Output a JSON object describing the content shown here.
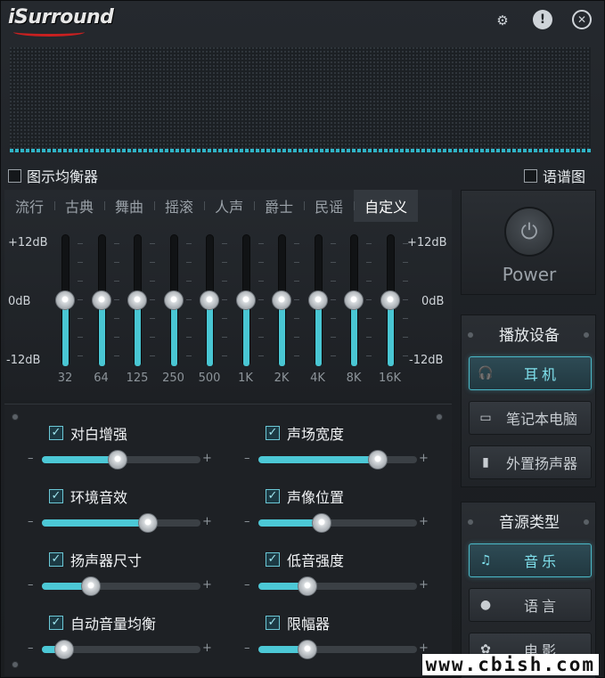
{
  "app": {
    "logo": "iSurround"
  },
  "header_icons": [
    "gear-icon",
    "info-icon",
    "close-icon"
  ],
  "options": {
    "graphic_eq": "图示均衡器",
    "spectrum": "语谱图"
  },
  "presets": [
    "流行",
    "古典",
    "舞曲",
    "摇滚",
    "人声",
    "爵士",
    "民谣",
    "自定义"
  ],
  "active_preset": "自定义",
  "eq": {
    "top_label": "+12dB",
    "mid_label": "0dB",
    "bottom_label": "-12dB",
    "bands": [
      {
        "freq": "32",
        "gain_db": 0
      },
      {
        "freq": "64",
        "gain_db": 0
      },
      {
        "freq": "125",
        "gain_db": 0
      },
      {
        "freq": "250",
        "gain_db": 0
      },
      {
        "freq": "500",
        "gain_db": 0
      },
      {
        "freq": "1K",
        "gain_db": 0
      },
      {
        "freq": "2K",
        "gain_db": 0
      },
      {
        "freq": "4K",
        "gain_db": 0
      },
      {
        "freq": "8K",
        "gain_db": 0
      },
      {
        "freq": "16K",
        "gain_db": 0
      }
    ]
  },
  "effects": [
    {
      "label": "对白增强",
      "checked": true,
      "level": 0.48
    },
    {
      "label": "声场宽度",
      "checked": true,
      "level": 0.75
    },
    {
      "label": "环境音效",
      "checked": true,
      "level": 0.67
    },
    {
      "label": "声像位置",
      "checked": true,
      "level": 0.4
    },
    {
      "label": "扬声器尺寸",
      "checked": true,
      "level": 0.31
    },
    {
      "label": "低音强度",
      "checked": true,
      "level": 0.31
    },
    {
      "label": "自动音量均衡",
      "checked": true,
      "level": 0.14
    },
    {
      "label": "限幅器",
      "checked": true,
      "level": 0.31
    }
  ],
  "slider_minus": "–",
  "slider_plus": "+",
  "power": {
    "label": "Power"
  },
  "playback": {
    "title": "播放设备",
    "items": [
      {
        "label": "耳机",
        "icon": "headphones-icon",
        "active": true
      },
      {
        "label": "笔记本电脑",
        "icon": "laptop-icon",
        "active": false
      },
      {
        "label": "外置扬声器",
        "icon": "speaker-icon",
        "active": false
      }
    ]
  },
  "source": {
    "title": "音源类型",
    "items": [
      {
        "label": "音乐",
        "icon": "music-note-icon",
        "active": true
      },
      {
        "label": "语言",
        "icon": "speech-icon",
        "active": false
      },
      {
        "label": "电影",
        "icon": "film-reel-icon",
        "active": false
      }
    ]
  },
  "watermark": "www.cbish.com",
  "colors": {
    "accent": "#49c6d3",
    "background": "#1c1f23"
  }
}
